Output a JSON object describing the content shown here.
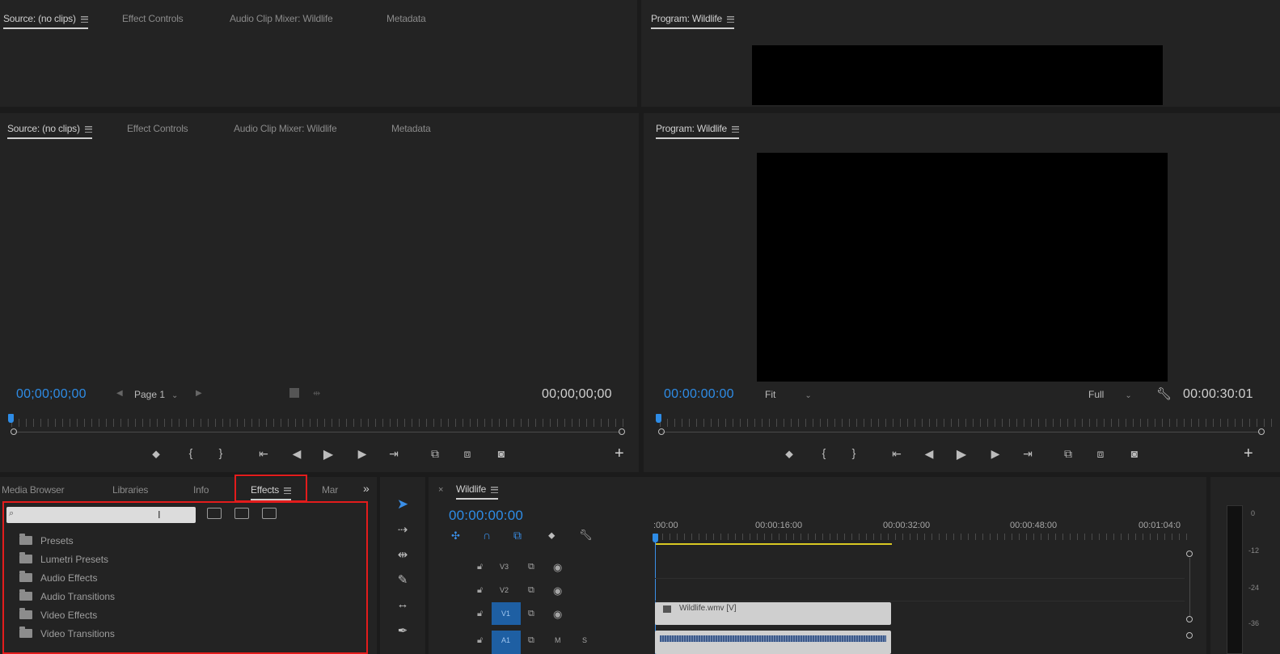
{
  "top_panel": {
    "source_tab": "Source: (no clips)",
    "effect_controls_tab": "Effect Controls",
    "audio_mixer_tab": "Audio Clip Mixer: Wildlife",
    "metadata_tab": "Metadata",
    "program_tab": "Program: Wildlife"
  },
  "source_monitor": {
    "tabs": {
      "source": "Source: (no clips)",
      "effect_controls": "Effect Controls",
      "audio_mixer": "Audio Clip Mixer: Wildlife",
      "metadata": "Metadata"
    },
    "timecode_left": "00;00;00;00",
    "page_select": "Page 1",
    "timecode_right": "00;00;00;00"
  },
  "program_monitor": {
    "tab": "Program: Wildlife",
    "timecode_left": "00:00:00:00",
    "fit_select": "Fit",
    "quality_select": "Full",
    "timecode_right": "00:00:30:01"
  },
  "effects_panel": {
    "tabs": {
      "media_browser": "Media Browser",
      "libraries": "Libraries",
      "info": "Info",
      "effects": "Effects",
      "markers": "Mar"
    },
    "search_value": "",
    "folders": [
      "Presets",
      "Lumetri Presets",
      "Audio Effects",
      "Audio Transitions",
      "Video Effects",
      "Video Transitions"
    ]
  },
  "timeline": {
    "sequence_tab": "Wildlife",
    "timecode": "00:00:00:00",
    "ruler_labels": [
      ":00:00",
      "00:00:16:00",
      "00:00:32:00",
      "00:00:48:00",
      "00:01:04:0"
    ],
    "tracks": [
      "V3",
      "V2",
      "V1",
      "A1"
    ],
    "clip_label": "Wildlife.wmv [V]",
    "audio_track_buttons": [
      "M",
      "S"
    ]
  },
  "audio_meter": {
    "scale": [
      "0",
      "-12",
      "-24",
      "-36"
    ]
  },
  "colors": {
    "accent_blue": "#2e8ce6",
    "highlight_red": "#e31c1c",
    "work_area_yellow": "#d9c823"
  }
}
